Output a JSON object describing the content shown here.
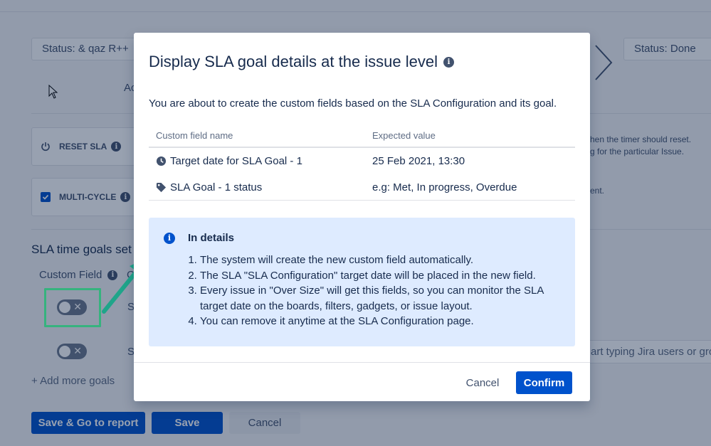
{
  "background": {
    "status_from": "Status: & qaz R++",
    "status_to": "Status: Done",
    "partial_tab": "Ac",
    "reset_sla_label": "RESET SLA",
    "reset_sla_desc_1": "hen the timer should reset.",
    "reset_sla_desc_2": "g for the particular Issue.",
    "multi_cycle_label": "MULTI-CYCLE",
    "multi_cycle_desc": "ent.",
    "section_title": "SLA time goals set",
    "custom_field_label": "Custom Field",
    "custom_field_next": "C",
    "row1_partial": "S",
    "row2_partial": "S",
    "users_placeholder": "art typing Jira users or gro",
    "add_more_goals": "+ Add more goals",
    "save_go_report": "Save & Go to report",
    "save": "Save",
    "cancel": "Cancel"
  },
  "modal": {
    "title": "Display SLA goal details at the issue level",
    "intro": "You are about to create the custom fields based on the SLA Configuration and its goal.",
    "table": {
      "headers": [
        "Custom field name",
        "Expected value"
      ],
      "rows": [
        {
          "icon": "clock-icon",
          "name": "Target date for SLA Goal - 1",
          "value": "25 Feb 2021, 13:30"
        },
        {
          "icon": "tag-icon",
          "name": "SLA Goal - 1 status",
          "value": "e.g: Met, In progress, Overdue"
        }
      ]
    },
    "details": {
      "heading": "In details",
      "items": [
        "The system will create the new custom field automatically.",
        "The SLA \"SLA Configuration\" target date will be placed in the new field.",
        "Every issue in \"Over Size\" will get this fields, so you can monitor the SLA target date on the boards, filters, gadgets, or issue layout.",
        "You can remove it anytime at the SLA Configuration page."
      ]
    },
    "cancel": "Cancel",
    "confirm": "Confirm"
  },
  "colors": {
    "primary": "#0052cc",
    "info_bg": "#deebff",
    "highlight": "#36b37e",
    "arrow": "#1fa58a"
  }
}
